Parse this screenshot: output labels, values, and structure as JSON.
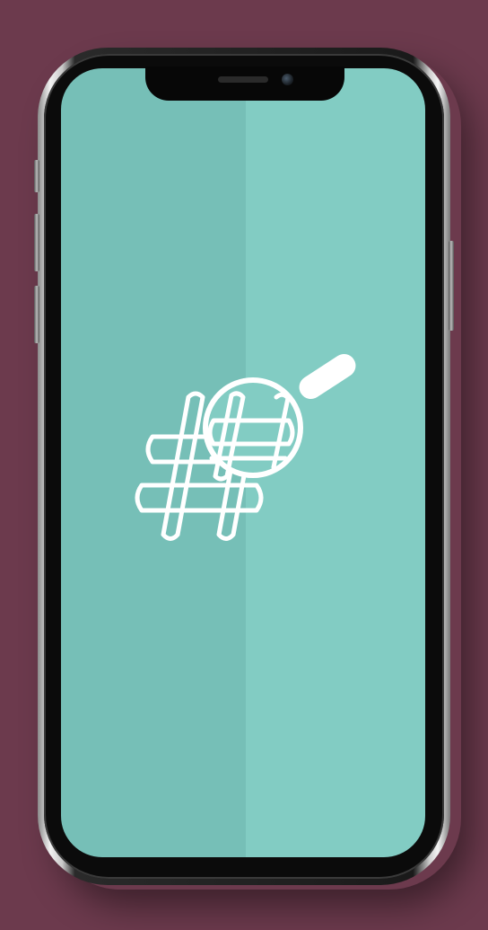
{
  "colors": {
    "background": "#6c3a4d",
    "screen_left": "#76bfb7",
    "screen_right": "#82ccc3",
    "logo_stroke": "#ffffff"
  },
  "device": {
    "type": "smartphone-mockup"
  },
  "screen": {
    "icon": "hashtag-search-icon"
  }
}
